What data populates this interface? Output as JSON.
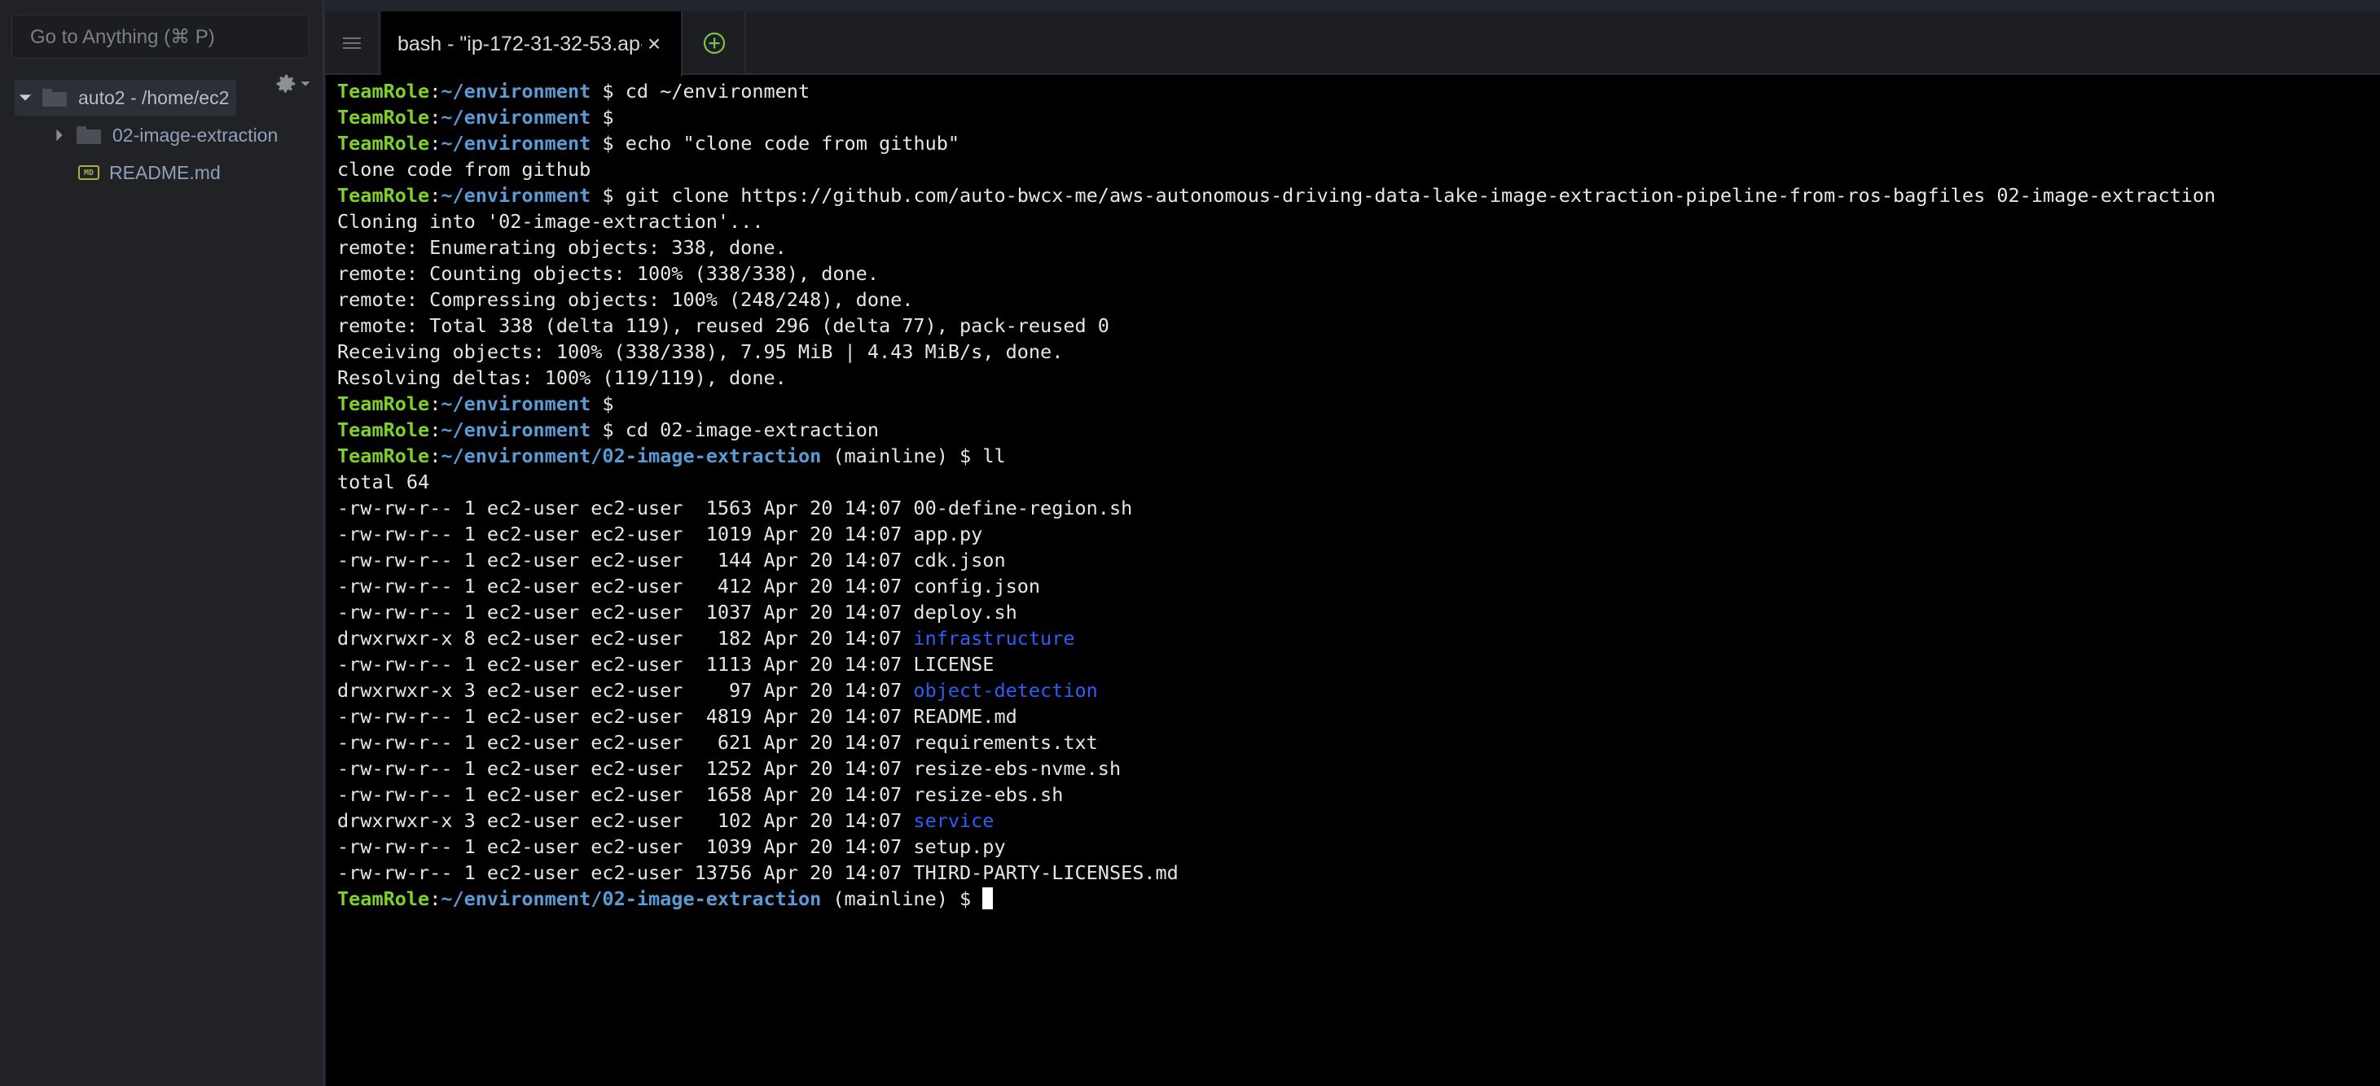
{
  "sidebar": {
    "goto_placeholder": "Go to Anything (⌘ P)",
    "tree": {
      "root_label": "auto2 - /home/ec2",
      "items": [
        {
          "label": "02-image-extraction",
          "type": "folder",
          "icon": "folder-icon"
        },
        {
          "label": "README.md",
          "type": "file",
          "icon": "markdown-file-icon"
        }
      ]
    },
    "settings_icon": "gear-icon"
  },
  "tabs": {
    "menu_icon": "hamburger-menu-icon",
    "active_tab_label": "bash - \"ip-172-31-32-53.ap-",
    "close_icon": "close-icon",
    "new_tab_icon": "plus-circle-icon"
  },
  "terminal": {
    "prompt_user": "TeamRole",
    "colors": {
      "prompt_user": "#7cd12a",
      "prompt_path": "#5b9bd5",
      "directory": "#2d5ef5",
      "text": "#e6e6e6",
      "background": "#000000"
    },
    "lines": [
      {
        "kind": "prompt",
        "path": "~/environment",
        "branch": "",
        "cmd": "cd ~/environment"
      },
      {
        "kind": "prompt",
        "path": "~/environment",
        "branch": "",
        "cmd": ""
      },
      {
        "kind": "prompt",
        "path": "~/environment",
        "branch": "",
        "cmd": "echo \"clone code from github\""
      },
      {
        "kind": "out",
        "text": "clone code from github"
      },
      {
        "kind": "prompt",
        "path": "~/environment",
        "branch": "",
        "cmd": "git clone https://github.com/auto-bwcx-me/aws-autonomous-driving-data-lake-image-extraction-pipeline-from-ros-bagfiles 02-image-extraction"
      },
      {
        "kind": "out",
        "text": "Cloning into '02-image-extraction'..."
      },
      {
        "kind": "out",
        "text": "remote: Enumerating objects: 338, done."
      },
      {
        "kind": "out",
        "text": "remote: Counting objects: 100% (338/338), done."
      },
      {
        "kind": "out",
        "text": "remote: Compressing objects: 100% (248/248), done."
      },
      {
        "kind": "out",
        "text": "remote: Total 338 (delta 119), reused 296 (delta 77), pack-reused 0"
      },
      {
        "kind": "out",
        "text": "Receiving objects: 100% (338/338), 7.95 MiB | 4.43 MiB/s, done."
      },
      {
        "kind": "out",
        "text": "Resolving deltas: 100% (119/119), done."
      },
      {
        "kind": "prompt",
        "path": "~/environment",
        "branch": "",
        "cmd": ""
      },
      {
        "kind": "prompt",
        "path": "~/environment",
        "branch": "",
        "cmd": "cd 02-image-extraction"
      },
      {
        "kind": "prompt",
        "path": "~/environment/02-image-extraction",
        "branch": "(mainline)",
        "cmd": "ll"
      },
      {
        "kind": "out",
        "text": "total 64"
      },
      {
        "kind": "ls",
        "meta": "-rw-rw-r-- 1 ec2-user ec2-user  1563 Apr 20 14:07 ",
        "name": "00-define-region.sh",
        "dir": false
      },
      {
        "kind": "ls",
        "meta": "-rw-rw-r-- 1 ec2-user ec2-user  1019 Apr 20 14:07 ",
        "name": "app.py",
        "dir": false
      },
      {
        "kind": "ls",
        "meta": "-rw-rw-r-- 1 ec2-user ec2-user   144 Apr 20 14:07 ",
        "name": "cdk.json",
        "dir": false
      },
      {
        "kind": "ls",
        "meta": "-rw-rw-r-- 1 ec2-user ec2-user   412 Apr 20 14:07 ",
        "name": "config.json",
        "dir": false
      },
      {
        "kind": "ls",
        "meta": "-rw-rw-r-- 1 ec2-user ec2-user  1037 Apr 20 14:07 ",
        "name": "deploy.sh",
        "dir": false
      },
      {
        "kind": "ls",
        "meta": "drwxrwxr-x 8 ec2-user ec2-user   182 Apr 20 14:07 ",
        "name": "infrastructure",
        "dir": true
      },
      {
        "kind": "ls",
        "meta": "-rw-rw-r-- 1 ec2-user ec2-user  1113 Apr 20 14:07 ",
        "name": "LICENSE",
        "dir": false
      },
      {
        "kind": "ls",
        "meta": "drwxrwxr-x 3 ec2-user ec2-user    97 Apr 20 14:07 ",
        "name": "object-detection",
        "dir": true
      },
      {
        "kind": "ls",
        "meta": "-rw-rw-r-- 1 ec2-user ec2-user  4819 Apr 20 14:07 ",
        "name": "README.md",
        "dir": false
      },
      {
        "kind": "ls",
        "meta": "-rw-rw-r-- 1 ec2-user ec2-user   621 Apr 20 14:07 ",
        "name": "requirements.txt",
        "dir": false
      },
      {
        "kind": "ls",
        "meta": "-rw-rw-r-- 1 ec2-user ec2-user  1252 Apr 20 14:07 ",
        "name": "resize-ebs-nvme.sh",
        "dir": false
      },
      {
        "kind": "ls",
        "meta": "-rw-rw-r-- 1 ec2-user ec2-user  1658 Apr 20 14:07 ",
        "name": "resize-ebs.sh",
        "dir": false
      },
      {
        "kind": "ls",
        "meta": "drwxrwxr-x 3 ec2-user ec2-user   102 Apr 20 14:07 ",
        "name": "service",
        "dir": true
      },
      {
        "kind": "ls",
        "meta": "-rw-rw-r-- 1 ec2-user ec2-user  1039 Apr 20 14:07 ",
        "name": "setup.py",
        "dir": false
      },
      {
        "kind": "ls",
        "meta": "-rw-rw-r-- 1 ec2-user ec2-user 13756 Apr 20 14:07 ",
        "name": "THIRD-PARTY-LICENSES.md",
        "dir": false
      },
      {
        "kind": "prompt",
        "path": "~/environment/02-image-extraction",
        "branch": "(mainline)",
        "cmd": "",
        "cursor": true
      }
    ]
  }
}
